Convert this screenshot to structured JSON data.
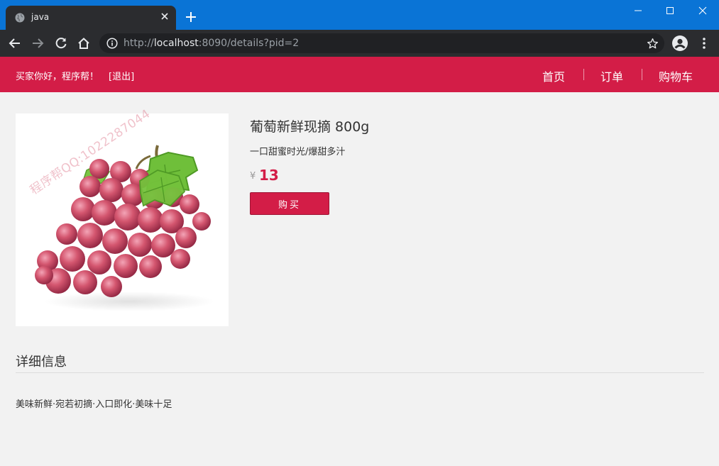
{
  "browser": {
    "tab_title": "java",
    "url_prefix": "http://",
    "url_host": "localhost",
    "url_rest": ":8090/details?pid=2"
  },
  "header": {
    "greeting": "买家你好，程序帮！",
    "logout": "[退出]",
    "nav": [
      "首页",
      "订单",
      "购物车"
    ]
  },
  "watermark": "程序帮QQ:1022287044",
  "product": {
    "title": "葡萄新鲜现摘 800g",
    "subtitle": "一口甜蜜时光/爆甜多汁",
    "currency": "¥",
    "price": "13",
    "buy_label": "购买"
  },
  "details": {
    "heading": "详细信息",
    "text": "美味新鲜·宛若初摘·入口即化·美味十足"
  },
  "colors": {
    "brand": "#d31d47",
    "titlebar": "#0a74d6",
    "chrome": "#2b2c2f"
  },
  "icons": [
    "globe-icon",
    "close-icon",
    "plus-icon",
    "minimize-icon",
    "maximize-icon",
    "back-arrow-icon",
    "forward-arrow-icon",
    "reload-icon",
    "home-icon",
    "info-icon",
    "star-icon",
    "profile-icon",
    "more-vert-icon"
  ]
}
